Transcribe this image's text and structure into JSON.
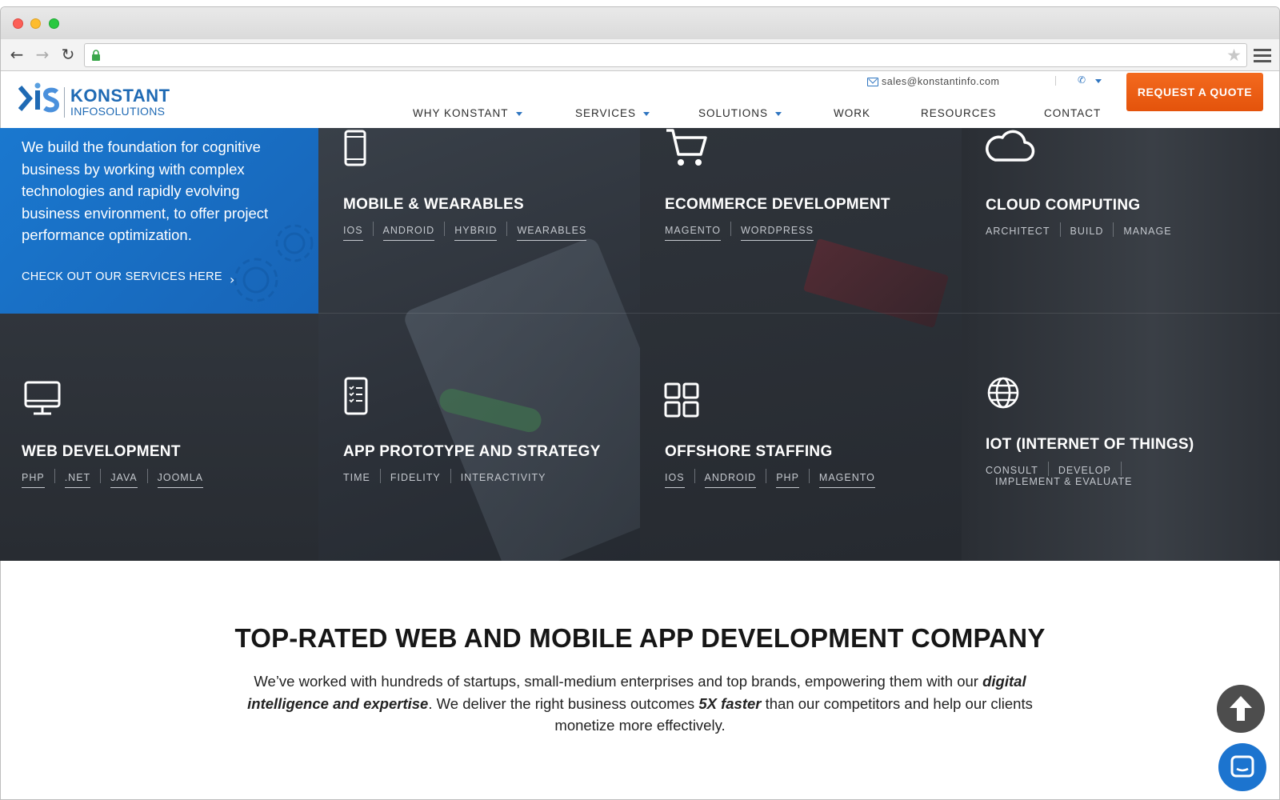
{
  "browser": {
    "url": "",
    "icons": {
      "back": "back-arrow-icon",
      "forward": "forward-arrow-icon",
      "reload": "reload-icon",
      "secure": "lock-icon",
      "bookmark": "star-icon",
      "menu": "hamburger-menu-icon"
    },
    "back_glyph": "←",
    "forward_glyph": "→",
    "reload_glyph": "↻",
    "star_glyph": "★"
  },
  "header": {
    "logo": {
      "word": "KONSTANT",
      "sub": "INFOSOLUTIONS"
    },
    "email": "sales@konstantinfo.com",
    "phone_glyph": "✆",
    "quote_button": "REQUEST A QUOTE",
    "nav": [
      {
        "label": "WHY KONSTANT",
        "dropdown": true
      },
      {
        "label": "SERVICES",
        "dropdown": true
      },
      {
        "label": "SOLUTIONS",
        "dropdown": true
      },
      {
        "label": "WORK",
        "dropdown": false
      },
      {
        "label": "RESOURCES",
        "dropdown": false
      },
      {
        "label": "CONTACT",
        "dropdown": false
      }
    ]
  },
  "intro": {
    "text": "We build the foundation for cognitive business by working with complex technologies and rapidly evolving business environment, to offer project performance optimization.",
    "link": "CHECK OUT OUR SERVICES HERE",
    "chevron": "›"
  },
  "tiles": [
    {
      "title": "MOBILE & WEARABLES",
      "icon": "smartphone-icon",
      "tags": [
        "IOS",
        "ANDROID",
        "HYBRID",
        "WEARABLES"
      ],
      "underlined": true
    },
    {
      "title": "ECOMMERCE DEVELOPMENT",
      "icon": "shopping-cart-icon",
      "tags": [
        "MAGENTO",
        "WORDPRESS"
      ],
      "underlined": true
    },
    {
      "title": "CLOUD COMPUTING",
      "icon": "cloud-icon",
      "tags": [
        "ARCHITECT",
        "BUILD",
        "MANAGE"
      ],
      "underlined": false
    },
    {
      "title": "WEB DEVELOPMENT",
      "icon": "desktop-monitor-icon",
      "tags": [
        "PHP",
        ".NET",
        "JAVA",
        "JOOMLA"
      ],
      "underlined": true
    },
    {
      "title": "APP PROTOTYPE AND STRATEGY",
      "icon": "mobile-checklist-icon",
      "tags": [
        "TIME",
        "FIDELITY",
        "INTERACTIVITY"
      ],
      "underlined": false
    },
    {
      "title": "OFFSHORE STAFFING",
      "icon": "grid-squares-icon",
      "tags": [
        "IOS",
        "ANDROID",
        "PHP",
        "MAGENTO"
      ],
      "underlined": true
    },
    {
      "title": "IOT (INTERNET OF THINGS)",
      "icon": "globe-icon",
      "tags": [
        "CONSULT",
        "DEVELOP",
        "IMPLEMENT & EVALUATE"
      ],
      "underlined": false
    }
  ],
  "section": {
    "headline": "TOP-RATED WEB AND MOBILE APP DEVELOPMENT COMPANY",
    "desc_1": "We’ve worked with hundreds of startups, small-medium enterprises and top brands, empowering them with our ",
    "desc_em_1": "digital intelligence and expertise",
    "desc_2": ". We deliver the right business outcomes ",
    "desc_em_2": "5X faster",
    "desc_3": " than our competitors and help our clients monetize more effectively."
  },
  "widgets": {
    "scroll_top_icon": "arrow-up-icon",
    "chat_icon": "chat-bubble-icon"
  },
  "colors": {
    "brand_blue": "#1f6ab4",
    "accent_orange": "#e85a12",
    "intro_blue": "#1a73c9",
    "tile_dark": "#2b3038"
  }
}
